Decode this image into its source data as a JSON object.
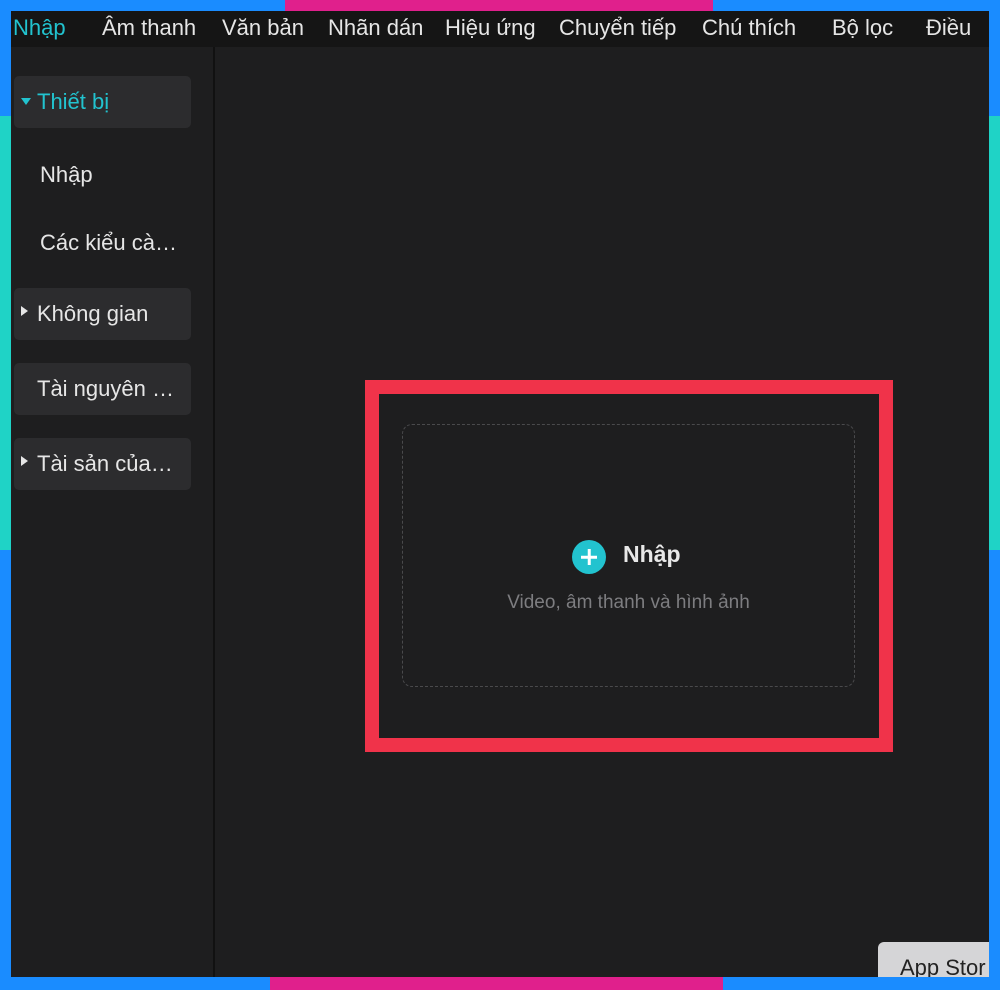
{
  "topnav": {
    "items": [
      {
        "label": "Nhập",
        "active": true
      },
      {
        "label": "Âm thanh"
      },
      {
        "label": "Văn bản"
      },
      {
        "label": "Nhãn dán"
      },
      {
        "label": "Hiệu ứng"
      },
      {
        "label": "Chuyển tiếp"
      },
      {
        "label": "Chú thích"
      },
      {
        "label": "Bộ lọc"
      },
      {
        "label": "Điều"
      }
    ]
  },
  "sidebar": {
    "groups": [
      {
        "label": "Thiết bị",
        "expanded": true,
        "children": [
          "Nhập",
          "Các kiểu cà…"
        ]
      },
      {
        "label": "Không gian",
        "expanded": false
      },
      {
        "label": "Tài nguyên …",
        "expanded": false
      },
      {
        "label": "Tài sản của…",
        "expanded": false
      }
    ]
  },
  "dropzone": {
    "title": "Nhập",
    "subtitle": "Video, âm thanh và hình ảnh"
  },
  "app_store_button": "App Stor",
  "colors": {
    "accent": "#22c3cf",
    "highlight": "#f0334a",
    "background": "#1e1e1f",
    "frame": "#1a8cff"
  }
}
